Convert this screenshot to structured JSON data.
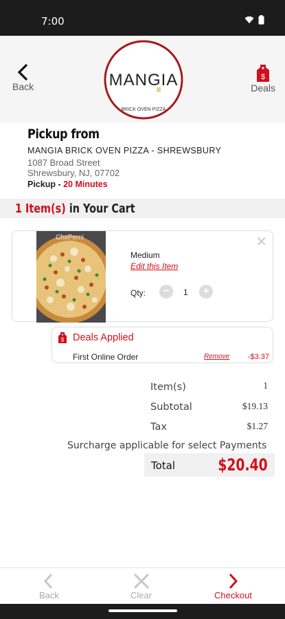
{
  "status_bar": {
    "time": "7:00"
  },
  "header": {
    "back_label": "Back",
    "deals_label": "Deals",
    "logo_text": "MANGIA",
    "logo_subtext": "BRICK OVEN PIZZA"
  },
  "pickup": {
    "title": "Pickup from",
    "store_name": "MANGIA BRICK OVEN PIZZA - SHREWSBURY",
    "address_line1": "1087 Broad Street",
    "address_line2": "Shrewsbury, NJ, 07702",
    "pickup_label": "Pickup -",
    "pickup_time": "20 Minutes"
  },
  "cart": {
    "count_text": "1 Item(s)",
    "suffix_text": "in Your Cart"
  },
  "item": {
    "image_caption": "ChxPerni",
    "size": "Medium",
    "edit_label": "Edit this Item",
    "qty_label": "Qty:",
    "qty_value": "1",
    "minus_glyph": "−",
    "plus_glyph": "+",
    "close_glyph": "✕"
  },
  "deals": {
    "title": "Deals Applied",
    "items": [
      {
        "name": "First Online Order",
        "remove_label": "Remove",
        "amount": "-$3.37"
      }
    ]
  },
  "summary": {
    "items_label": "Item(s)",
    "items_value": "1",
    "subtotal_label": "Subtotal",
    "subtotal_value": "$19.13",
    "tax_label": "Tax",
    "tax_value": "$1.27",
    "surcharge_note": "Surcharge applicable for select Payments",
    "total_label": "Total",
    "total_value": "$20.40"
  },
  "bottom_nav": {
    "back_label": "Back",
    "clear_label": "Clear",
    "checkout_label": "Checkout"
  },
  "colors": {
    "accent_red": "#d0101c",
    "status_bar": "#1c1c1c"
  }
}
